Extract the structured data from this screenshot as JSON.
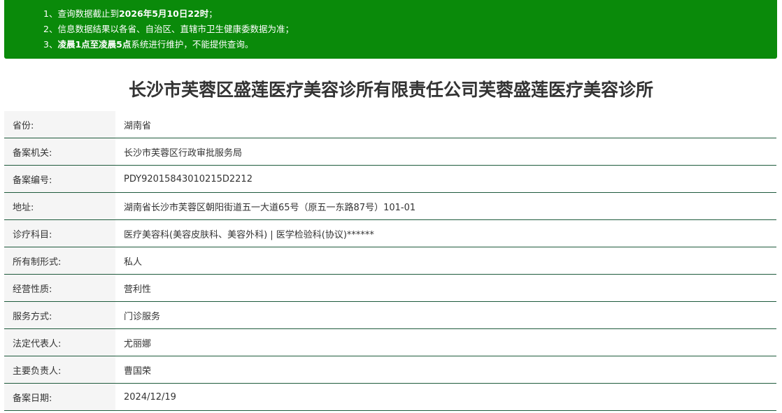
{
  "notice": {
    "line1": {
      "prefix": "1、查询数据截止到",
      "date": "2026年5月10日22时",
      "suffix": "；"
    },
    "line2": {
      "text": "2、信息数据结果以各省、自治区、直辖市卫生健康委数据为准；"
    },
    "line3": {
      "prefix": "3、",
      "time": "凌晨1点至凌晨5点",
      "suffix": "系统进行维护，不能提供查询。"
    }
  },
  "title": "长沙市芙蓉区盛莲医疗美容诊所有限责任公司芙蓉盛莲医疗美容诊所",
  "fields": [
    {
      "label": "省份:",
      "value": "湖南省"
    },
    {
      "label": "备案机关:",
      "value": "长沙市芙蓉区行政审批服务局"
    },
    {
      "label": "备案编号:",
      "value": "PDY92015843010215D2212"
    },
    {
      "label": "地址:",
      "value": "湖南省长沙市芙蓉区朝阳街道五一大道65号（原五一东路87号）101-01"
    },
    {
      "label": "诊疗科目:",
      "value": "医疗美容科(美容皮肤科、美容外科) | 医学检验科(协议)******"
    },
    {
      "label": "所有制形式:",
      "value": "私人"
    },
    {
      "label": "经营性质:",
      "value": "营利性"
    },
    {
      "label": "服务方式:",
      "value": "门诊服务"
    },
    {
      "label": "法定代表人:",
      "value": "尤丽娜"
    },
    {
      "label": "主要负责人:",
      "value": "曹国荣"
    },
    {
      "label": "备案日期:",
      "value": "2024/12/19"
    }
  ],
  "colors": {
    "notice_bg": "#0a8a0a",
    "row_border": "#1e5a3c",
    "label_bg": "#f5f5f5"
  }
}
